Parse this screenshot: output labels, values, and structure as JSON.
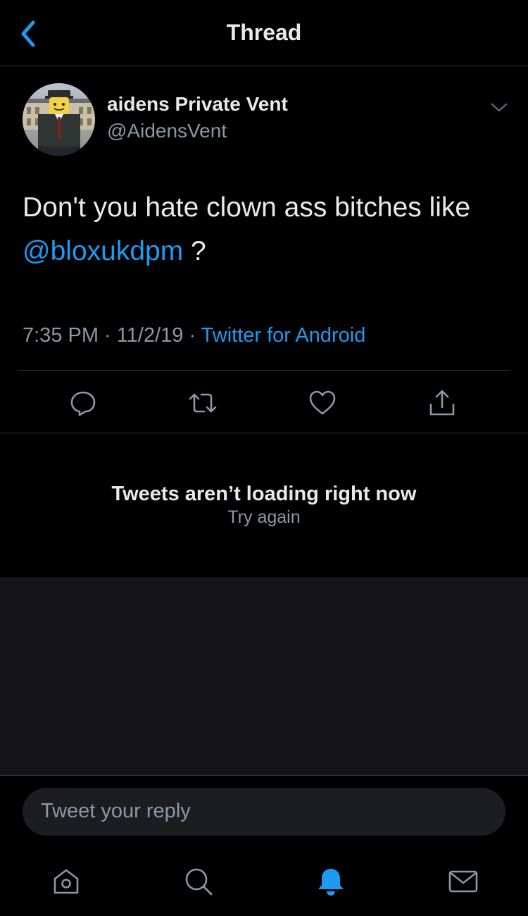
{
  "header": {
    "title": "Thread"
  },
  "tweet": {
    "display_name": "aidens Private Vent",
    "handle": "@AidensVent",
    "text_before": "Don't you hate clown ass bitches like ",
    "mention": "@bloxukdpm",
    "text_after": " ?",
    "time": "7:35 PM",
    "date": "11/2/19",
    "separator": " · ",
    "source": "Twitter for Android"
  },
  "actions": {
    "reply_icon": "reply-icon",
    "retweet_icon": "retweet-icon",
    "like_icon": "heart-icon",
    "share_icon": "share-icon"
  },
  "error": {
    "title": "Tweets aren’t loading right now",
    "retry": "Try again"
  },
  "reply": {
    "placeholder": "Tweet your reply"
  },
  "nav": {
    "items": [
      "home-icon",
      "search-icon",
      "notifications-icon",
      "messages-icon"
    ],
    "active": "notifications-icon"
  },
  "colors": {
    "background": "#000000",
    "accent": "#1d9bf0",
    "secondary_text": "#8b98a5",
    "primary_text": "#e7e9ea",
    "empty_panel": "#151518"
  }
}
